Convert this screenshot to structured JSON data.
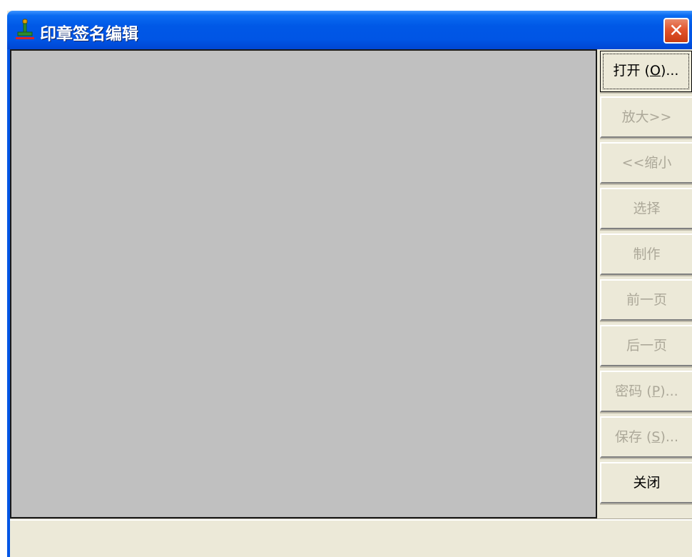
{
  "window": {
    "title": "印章签名编辑",
    "close_label": "✕"
  },
  "icons": {
    "app": "stamp-icon",
    "close": "close-icon"
  },
  "buttons": [
    {
      "pre": "打开 (",
      "accel": "O",
      "post": ")...",
      "enabled": true
    },
    {
      "pre": "放大>>",
      "accel": "",
      "post": "",
      "enabled": false
    },
    {
      "pre": "<<缩小",
      "accel": "",
      "post": "",
      "enabled": false
    },
    {
      "pre": "选择",
      "accel": "",
      "post": "",
      "enabled": false
    },
    {
      "pre": "制作",
      "accel": "",
      "post": "",
      "enabled": false
    },
    {
      "pre": "前一页",
      "accel": "",
      "post": "",
      "enabled": false
    },
    {
      "pre": "后一页",
      "accel": "",
      "post": "",
      "enabled": false
    },
    {
      "pre": "密码 (",
      "accel": "P",
      "post": ")...",
      "enabled": false
    },
    {
      "pre": "保存 (",
      "accel": "S",
      "post": ")...",
      "enabled": false
    },
    {
      "pre": "关闭",
      "accel": "",
      "post": "",
      "enabled": true
    }
  ],
  "colors": {
    "titlebar": "#0055e5",
    "canvas": "#c0c0c0",
    "face": "#ece9d8",
    "close": "#e2552d"
  }
}
